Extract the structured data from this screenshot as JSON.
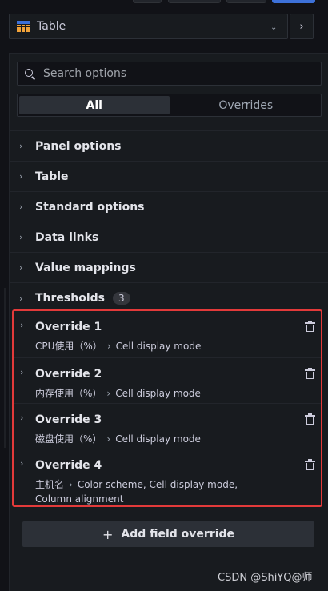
{
  "viz": {
    "label": "Table",
    "next_icon": "chevron-right-icon",
    "dropdown_icon": "chevron-down-icon"
  },
  "search": {
    "placeholder": "Search options"
  },
  "tabs": [
    {
      "label": "All",
      "active": true
    },
    {
      "label": "Overrides",
      "active": false
    }
  ],
  "categories": [
    {
      "label": "Panel options"
    },
    {
      "label": "Table"
    },
    {
      "label": "Standard options"
    },
    {
      "label": "Data links"
    },
    {
      "label": "Value mappings"
    },
    {
      "label": "Thresholds",
      "badge": "3"
    }
  ],
  "overrides": [
    {
      "title": "Override 1",
      "field": "CPU使用（%）",
      "props": "Cell display mode"
    },
    {
      "title": "Override 2",
      "field": "内存使用（%）",
      "props": "Cell display mode"
    },
    {
      "title": "Override 3",
      "field": "磁盘使用（%）",
      "props": "Cell display mode"
    },
    {
      "title": "Override 4",
      "field": "主机名",
      "props": "Color scheme, Cell display mode, Column alignment"
    }
  ],
  "add_override": {
    "label": "Add field override"
  },
  "watermark": "CSDN @ShiYQ@师",
  "colors": {
    "highlight": "#e33a3a",
    "accent": "#3d71d9"
  }
}
